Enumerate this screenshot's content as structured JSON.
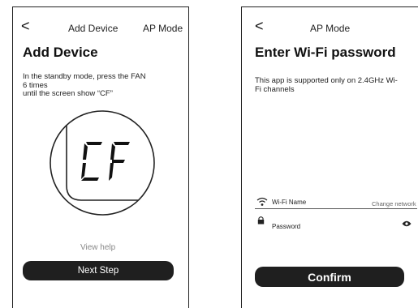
{
  "left_screen": {
    "back_glyph": "<",
    "nav_title": "Add Device",
    "nav_right": "AP Mode",
    "title": "Add Device",
    "instruction_line1": "In the standby mode, press the FAN",
    "instruction_line2": "6 times",
    "instruction_line3": "until the screen show “CF”",
    "display_code": "CF",
    "view_help": "View help",
    "next_button": "Next Step"
  },
  "right_screen": {
    "back_glyph": "<",
    "nav_title": "AP Mode",
    "title": "Enter Wi-Fi password",
    "note_line1": "This app is supported only on 2.4GHz Wi-",
    "note_line2": "Fi channels",
    "wifi_label": "Wi-Fi Name",
    "change_network": "Change network",
    "password_label": "Password",
    "confirm_button": "Confirm"
  },
  "icons": {
    "back": "chevron-left-icon",
    "wifi": "wifi-icon",
    "lock": "lock-icon",
    "eye": "eye-icon"
  }
}
